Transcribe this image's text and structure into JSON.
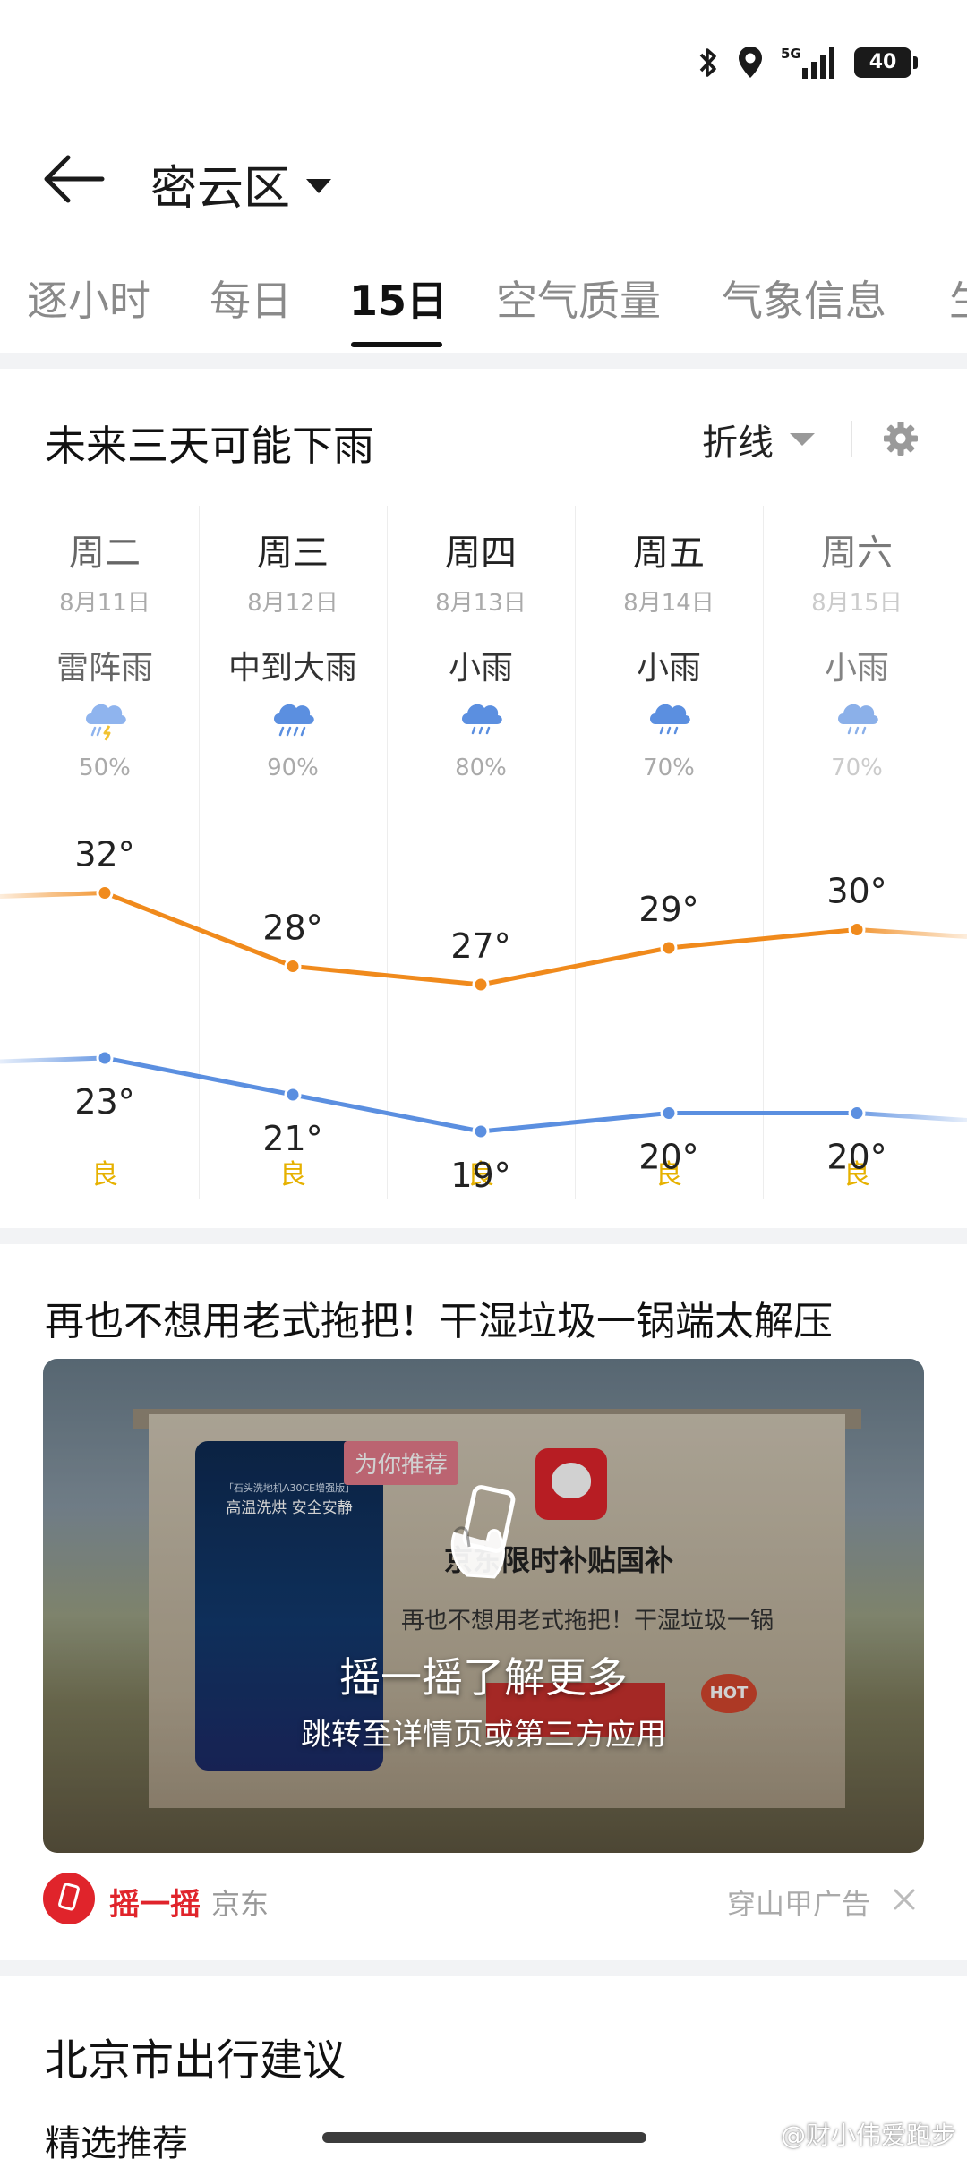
{
  "status_bar": {
    "icons": [
      "bluetooth-icon",
      "location-icon",
      "signal-5g-icon"
    ],
    "network": "5G",
    "battery": "40"
  },
  "header": {
    "location": "密云区"
  },
  "tabs": [
    "逐小时",
    "每日",
    "15日",
    "空气质量",
    "气象信息"
  ],
  "active_tab": "15日",
  "forecast": {
    "title": "未来三天可能下雨",
    "view_mode": "折线",
    "days": [
      {
        "name": "周二",
        "date": "8月11日",
        "condition": "雷阵雨",
        "icon": "thunder-rain-icon",
        "precip": "50%",
        "high": "32°",
        "low": "23°",
        "aqi": "良"
      },
      {
        "name": "周三",
        "date": "8月12日",
        "condition": "中到大雨",
        "icon": "heavy-rain-icon",
        "precip": "90%",
        "high": "28°",
        "low": "21°",
        "aqi": "良"
      },
      {
        "name": "周四",
        "date": "8月13日",
        "condition": "小雨",
        "icon": "light-rain-icon",
        "precip": "80%",
        "high": "27°",
        "low": "19°",
        "aqi": "良"
      },
      {
        "name": "周五",
        "date": "8月14日",
        "condition": "小雨",
        "icon": "light-rain-icon",
        "precip": "70%",
        "high": "29°",
        "low": "20°",
        "aqi": "良"
      },
      {
        "name": "周六",
        "date": "8月15日",
        "condition": "小雨",
        "icon": "light-rain-icon",
        "precip": "70%",
        "high": "30°",
        "low": "20°",
        "aqi": "良"
      }
    ],
    "high_values": [
      32,
      28,
      27,
      29,
      30
    ],
    "low_values": [
      23,
      21,
      19,
      20,
      20
    ],
    "colors": {
      "high": "#f08a1c",
      "low": "#5b8fe0",
      "aqi": "#e6b100"
    }
  },
  "ad": {
    "title": "再也不想用老式拖把！干湿垃圾一锅端太解压",
    "poster_line1": "「石头洗地机A30CE增强版」",
    "poster_line2": "高温洗烘 安全安静",
    "tag": "为你推荐",
    "brand": "京东限时补贴国补",
    "subtitle": "再也不想用老式拖把！干湿垃圾一锅",
    "hot": "HOT",
    "shake_title": "摇一摇了解更多",
    "shake_subtitle": "跳转至详情页或第三方应用",
    "footer_label": "摇一摇",
    "advertiser": "京东",
    "source": "穿山甲广告"
  },
  "travel": {
    "title": "北京市出行建议",
    "picks": "精选推荐"
  },
  "watermark": "@财小伟爱跑步"
}
